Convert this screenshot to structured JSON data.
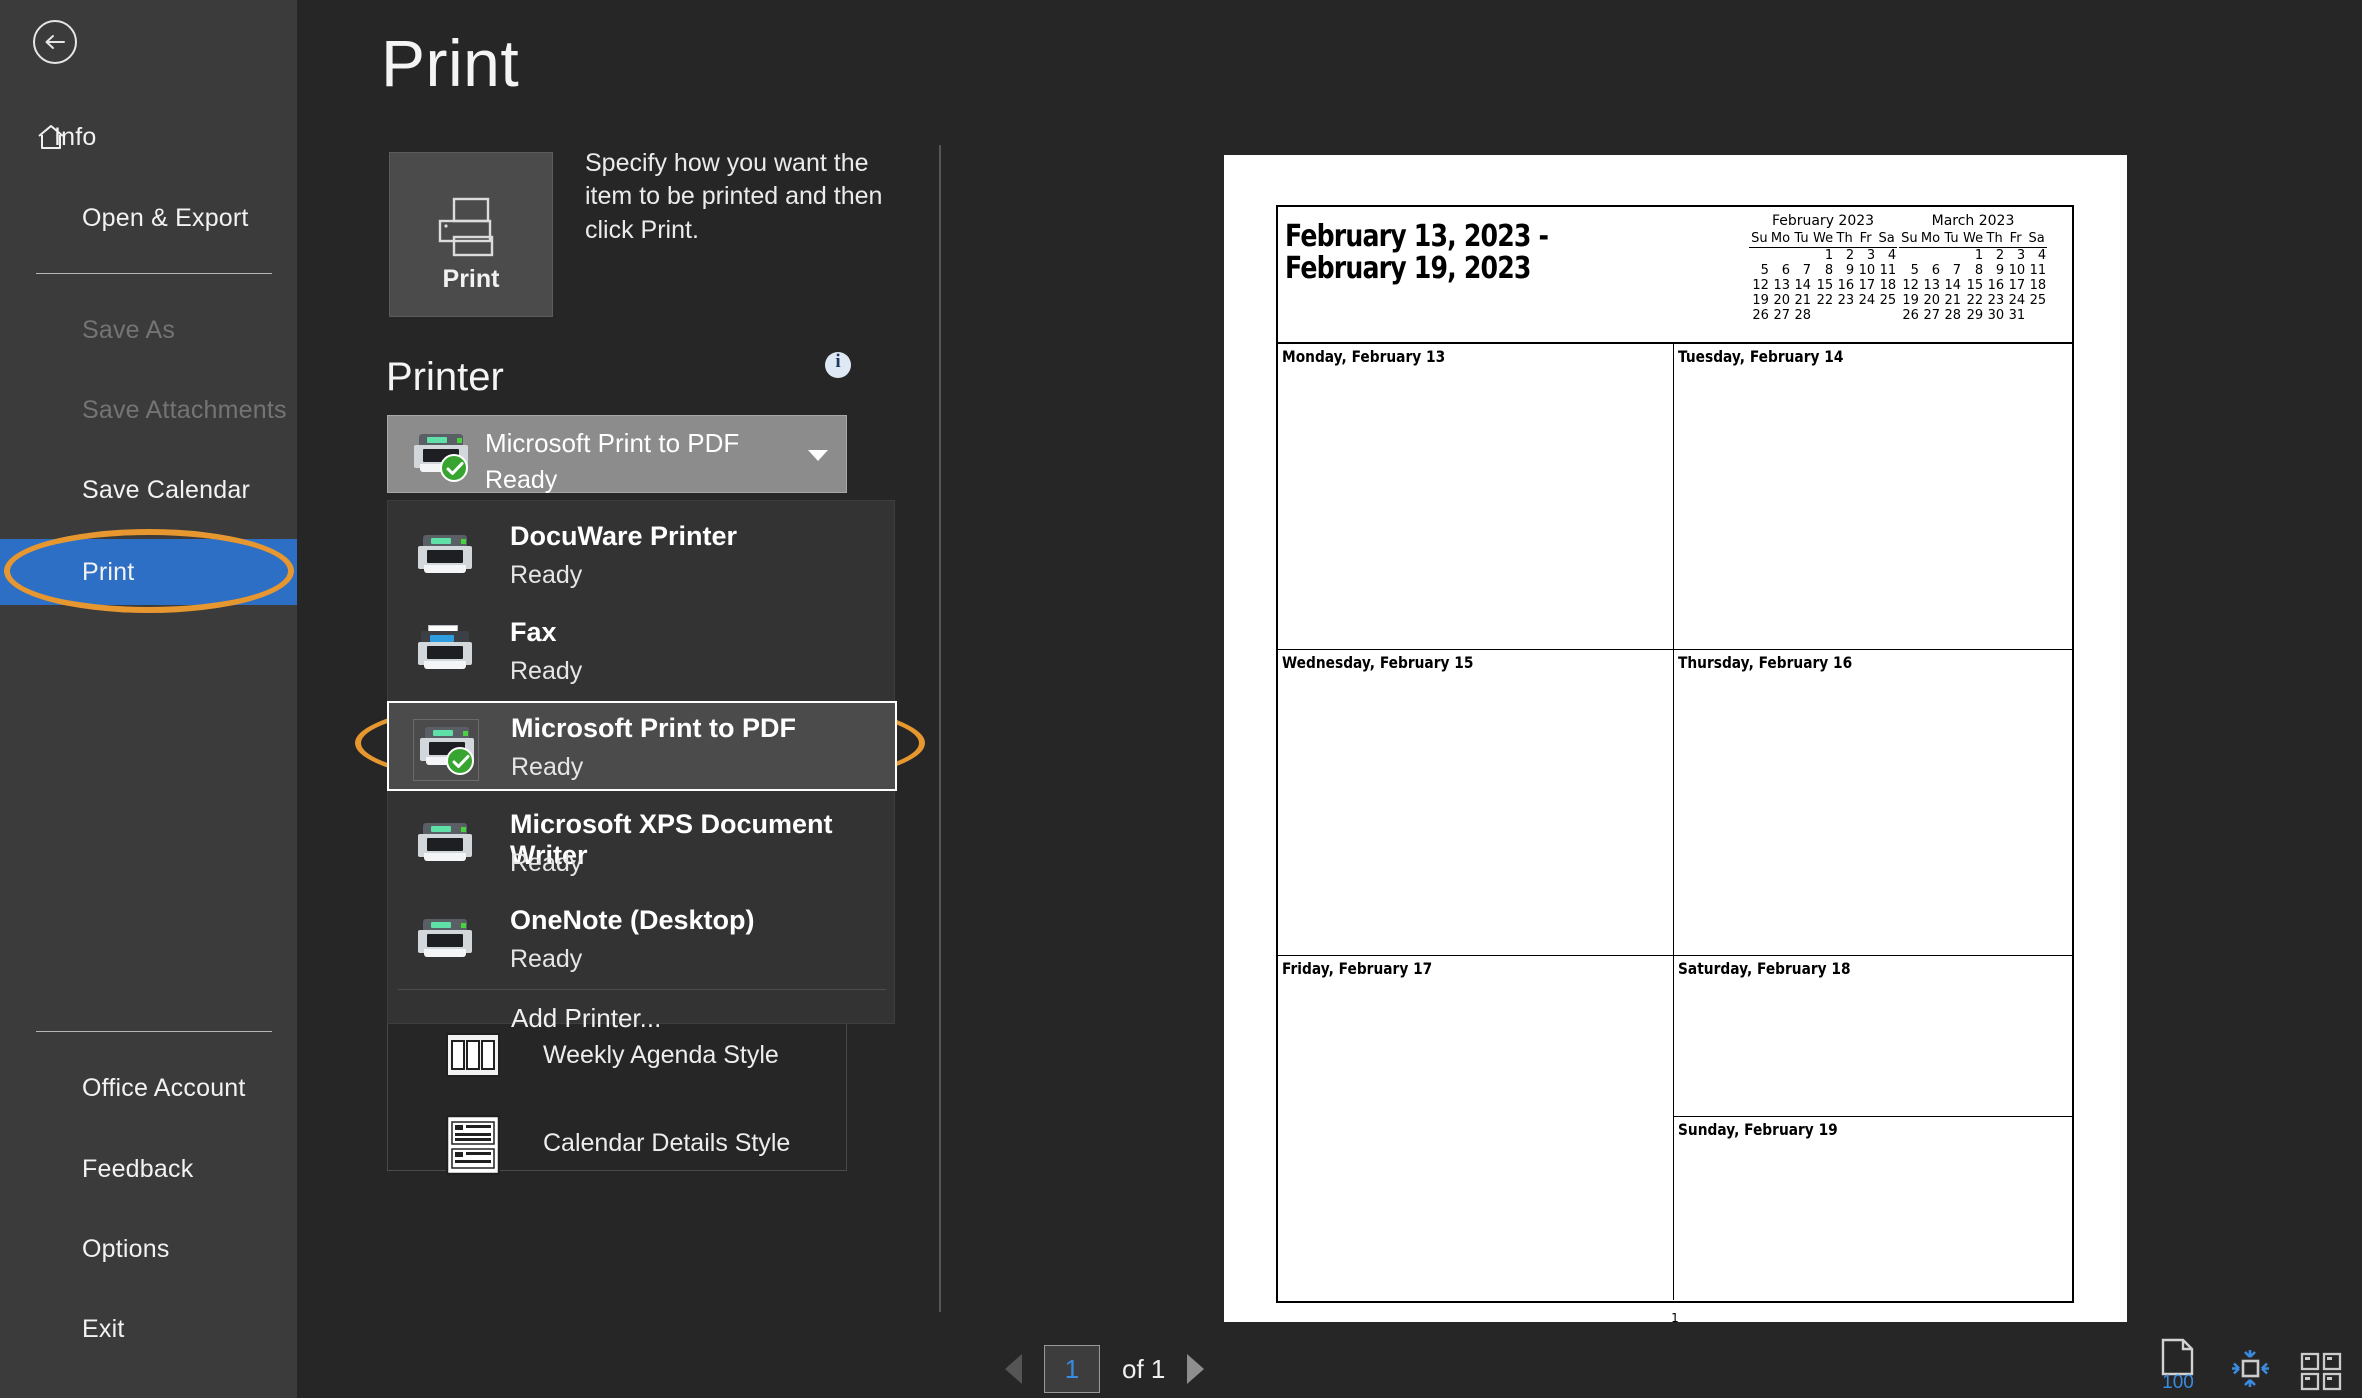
{
  "app": {
    "backstage_title": "Print"
  },
  "sidebar": {
    "back_label": "Back",
    "items": [
      {
        "label": "Info",
        "icon": "home-icon",
        "state": "normal"
      },
      {
        "label": "Open & Export",
        "icon": "none",
        "state": "normal"
      },
      {
        "label": "Save As",
        "icon": "none",
        "state": "disabled"
      },
      {
        "label": "Save Attachments",
        "icon": "none",
        "state": "disabled"
      },
      {
        "label": "Save Calendar",
        "icon": "none",
        "state": "normal"
      },
      {
        "label": "Print",
        "icon": "none",
        "state": "selected"
      },
      {
        "label": "Office Account",
        "icon": "none",
        "state": "normal"
      },
      {
        "label": "Feedback",
        "icon": "none",
        "state": "normal"
      },
      {
        "label": "Options",
        "icon": "none",
        "state": "normal"
      },
      {
        "label": "Exit",
        "icon": "none",
        "state": "normal"
      }
    ]
  },
  "print_pane": {
    "title": "Print",
    "print_button_label": "Print",
    "description": "Specify how you want the item to be printed and then click Print.",
    "printer_section_heading": "Printer",
    "info_icon_label": "i",
    "selected_printer": {
      "name": "Microsoft Print to PDF",
      "status": "Ready"
    },
    "printer_dropdown": {
      "items": [
        {
          "name": "DocuWare Printer",
          "status": "Ready",
          "icon": "printer-icon",
          "selected": false
        },
        {
          "name": "Fax",
          "status": "Ready",
          "icon": "fax-printer-icon",
          "selected": false
        },
        {
          "name": "Microsoft Print to PDF",
          "status": "Ready",
          "icon": "printer-icon",
          "selected": true
        },
        {
          "name": "Microsoft XPS Document Writer",
          "status": "Ready",
          "icon": "printer-icon",
          "selected": false
        },
        {
          "name": "OneNote (Desktop)",
          "status": "Ready",
          "icon": "printer-icon",
          "selected": false
        }
      ],
      "add_printer_label": "Add Printer..."
    },
    "settings": {
      "styles": [
        {
          "label": "Weekly Agenda Style",
          "icon": "weekly-agenda-style-icon"
        },
        {
          "label": "Calendar Details Style",
          "icon": "calendar-details-style-icon"
        }
      ]
    }
  },
  "preview": {
    "calendar": {
      "range_line1": "February 13, 2023 -",
      "range_line2": "February 19, 2023",
      "page_number": "1",
      "mini_calendars": [
        {
          "title": "February 2023",
          "weekday_headers": [
            "Su",
            "Mo",
            "Tu",
            "We",
            "Th",
            "Fr",
            "Sa"
          ],
          "weeks": [
            [
              "",
              "",
              "",
              "1",
              "2",
              "3",
              "4"
            ],
            [
              "5",
              "6",
              "7",
              "8",
              "9",
              "10",
              "11"
            ],
            [
              "12",
              "13",
              "14",
              "15",
              "16",
              "17",
              "18"
            ],
            [
              "19",
              "20",
              "21",
              "22",
              "23",
              "24",
              "25"
            ],
            [
              "26",
              "27",
              "28",
              "",
              "",
              "",
              ""
            ]
          ]
        },
        {
          "title": "March 2023",
          "weekday_headers": [
            "Su",
            "Mo",
            "Tu",
            "We",
            "Th",
            "Fr",
            "Sa"
          ],
          "weeks": [
            [
              "",
              "",
              "",
              "1",
              "2",
              "3",
              "4"
            ],
            [
              "5",
              "6",
              "7",
              "8",
              "9",
              "10",
              "11"
            ],
            [
              "12",
              "13",
              "14",
              "15",
              "16",
              "17",
              "18"
            ],
            [
              "19",
              "20",
              "21",
              "22",
              "23",
              "24",
              "25"
            ],
            [
              "26",
              "27",
              "28",
              "29",
              "30",
              "31",
              ""
            ]
          ]
        }
      ],
      "days": [
        {
          "label": "Monday, February 13",
          "content": ""
        },
        {
          "label": "Tuesday, February 14",
          "content": ""
        },
        {
          "label": "Wednesday, February 15",
          "content": ""
        },
        {
          "label": "Thursday, February 16",
          "content": ""
        },
        {
          "label": "Friday, February 17",
          "content": ""
        },
        {
          "label": "Saturday, February 18",
          "content": ""
        },
        {
          "label": "Sunday, February 19",
          "content": ""
        }
      ]
    }
  },
  "bottom_bar": {
    "prev_page_label": "Previous Page",
    "next_page_label": "Next Page",
    "current_page": "1",
    "of_label": "of 1",
    "zoom_tools": [
      {
        "name": "actual-size-icon",
        "label": "100"
      },
      {
        "name": "fit-to-page-icon",
        "label": ""
      },
      {
        "name": "multiple-pages-icon",
        "label": ""
      }
    ]
  },
  "annotations": {
    "highlight_color": "#e7972f",
    "ellipses": [
      {
        "target": "sidebar-item-print"
      },
      {
        "target": "printer-dropdown-item-microsoft-print-to-pdf"
      }
    ]
  }
}
